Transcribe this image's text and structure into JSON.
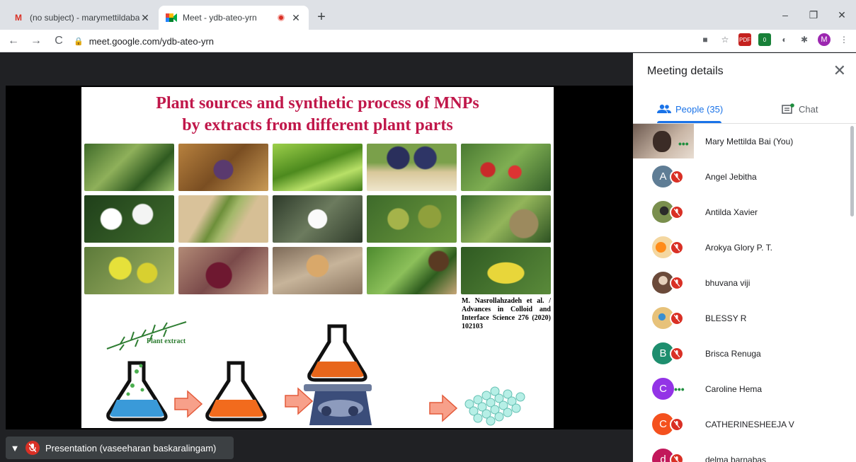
{
  "browser": {
    "tabs": [
      {
        "title": "(no subject) - marymettildabai@",
        "favicon": "gmail-icon"
      },
      {
        "title": "Meet - ydb-ateo-yrn",
        "favicon": "meet-icon",
        "recording": true
      }
    ],
    "new_tab": "+",
    "window_controls": [
      "–",
      "❐",
      "✕"
    ],
    "url": "meet.google.com/ydb-ateo-yrn",
    "profile_initial": "M",
    "extension_badge": "0"
  },
  "slide": {
    "title_line1": "Plant sources and synthetic process of MNPs",
    "title_line2": "by extracts from different plant parts",
    "citation": "M. Nasrollahzadeh et al. / Advances in Colloid and Interface Science 276 (2020) 102103",
    "plant_label": "Plant extract"
  },
  "presentation_chip": "Presentation (vaseeharan baskaralingam)",
  "panel": {
    "title": "Meeting details",
    "people_tab": "People (35)",
    "chat_tab": "Chat",
    "people": [
      {
        "name": "Mary Mettilda Bai (You)",
        "initial": "",
        "color": "#8d6e63",
        "state": "speaking"
      },
      {
        "name": "Angel Jebitha",
        "initial": "A",
        "color": "#5f7d95",
        "state": "muted"
      },
      {
        "name": "Antilda Xavier",
        "initial": "",
        "color": "#7a8f4e",
        "state": "muted"
      },
      {
        "name": "Arokya Glory P. T.",
        "initial": "",
        "color": "#f4a340",
        "state": "muted"
      },
      {
        "name": "bhuvana viji",
        "initial": "",
        "color": "#8b6a5a",
        "state": "muted"
      },
      {
        "name": "BLESSY R",
        "initial": "",
        "color": "#d9b46a",
        "state": "muted"
      },
      {
        "name": "Brisca Renuga",
        "initial": "B",
        "color": "#1e8e6e",
        "state": "muted"
      },
      {
        "name": "Caroline Hema",
        "initial": "C",
        "color": "#9334e6",
        "state": "speaking"
      },
      {
        "name": "CATHERINESHEEJA V",
        "initial": "C",
        "color": "#f4511e",
        "state": "muted"
      },
      {
        "name": "delma barnabas",
        "initial": "d",
        "color": "#c2185b",
        "state": "muted"
      }
    ]
  }
}
